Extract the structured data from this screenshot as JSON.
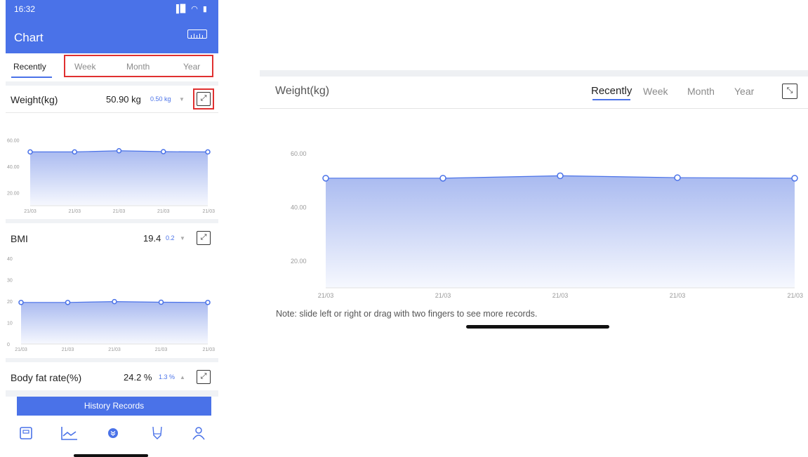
{
  "phone": {
    "status": {
      "time": "16:32",
      "icons": "▐▉ ◠ ▮"
    },
    "title": "Chart",
    "tabs": [
      "Recently",
      "Week",
      "Month",
      "Year"
    ],
    "metrics": [
      {
        "name": "Weight(kg)",
        "value": "50.90 kg",
        "delta": "0.50 kg",
        "direction": "down"
      },
      {
        "name": "BMI",
        "value": "19.4",
        "delta": "0.2",
        "direction": "down"
      },
      {
        "name": "Body fat rate(%)",
        "value": "24.2 %",
        "delta": "1.3 %",
        "direction": "up"
      }
    ],
    "history_button": "History Records",
    "nav_icons": [
      "scale-icon",
      "chart-icon",
      "chevron-circle-icon",
      "body-icon",
      "profile-icon"
    ]
  },
  "landscape": {
    "title": "Weight(kg)",
    "tabs": [
      "Recently",
      "Week",
      "Month",
      "Year"
    ],
    "active_tab": "Recently",
    "note": "Note: slide left or right or drag with two fingers to see more records."
  },
  "colors": {
    "accent": "#4a72e8",
    "highlight": "#e03030",
    "fill_top": "#a9baf0",
    "fill_bottom": "#f6f8fe"
  },
  "chart_data": [
    {
      "type": "area",
      "x": [
        "21/03",
        "21/03",
        "21/03",
        "21/03",
        "21/03"
      ],
      "y_ticks": [
        "60.00",
        "40.00",
        "20.00"
      ],
      "values": [
        50.9,
        50.9,
        51.8,
        51.1,
        50.9
      ],
      "ylim": [
        10,
        65
      ]
    },
    {
      "type": "area",
      "x": [
        "21/03",
        "21/03",
        "21/03",
        "21/03",
        "21/03"
      ],
      "y_ticks": [
        "40",
        "30",
        "20",
        "10",
        "0"
      ],
      "values": [
        19.4,
        19.4,
        19.8,
        19.5,
        19.4
      ],
      "ylim": [
        0,
        40
      ]
    },
    {
      "type": "area",
      "x": [
        "21/03",
        "21/03",
        "21/03",
        "21/03",
        "21/03"
      ],
      "y_ticks": [
        "60.00",
        "40.00",
        "20.00"
      ],
      "values": [
        50.9,
        50.9,
        51.8,
        51.1,
        50.9
      ],
      "ylim": [
        10,
        65
      ]
    }
  ]
}
